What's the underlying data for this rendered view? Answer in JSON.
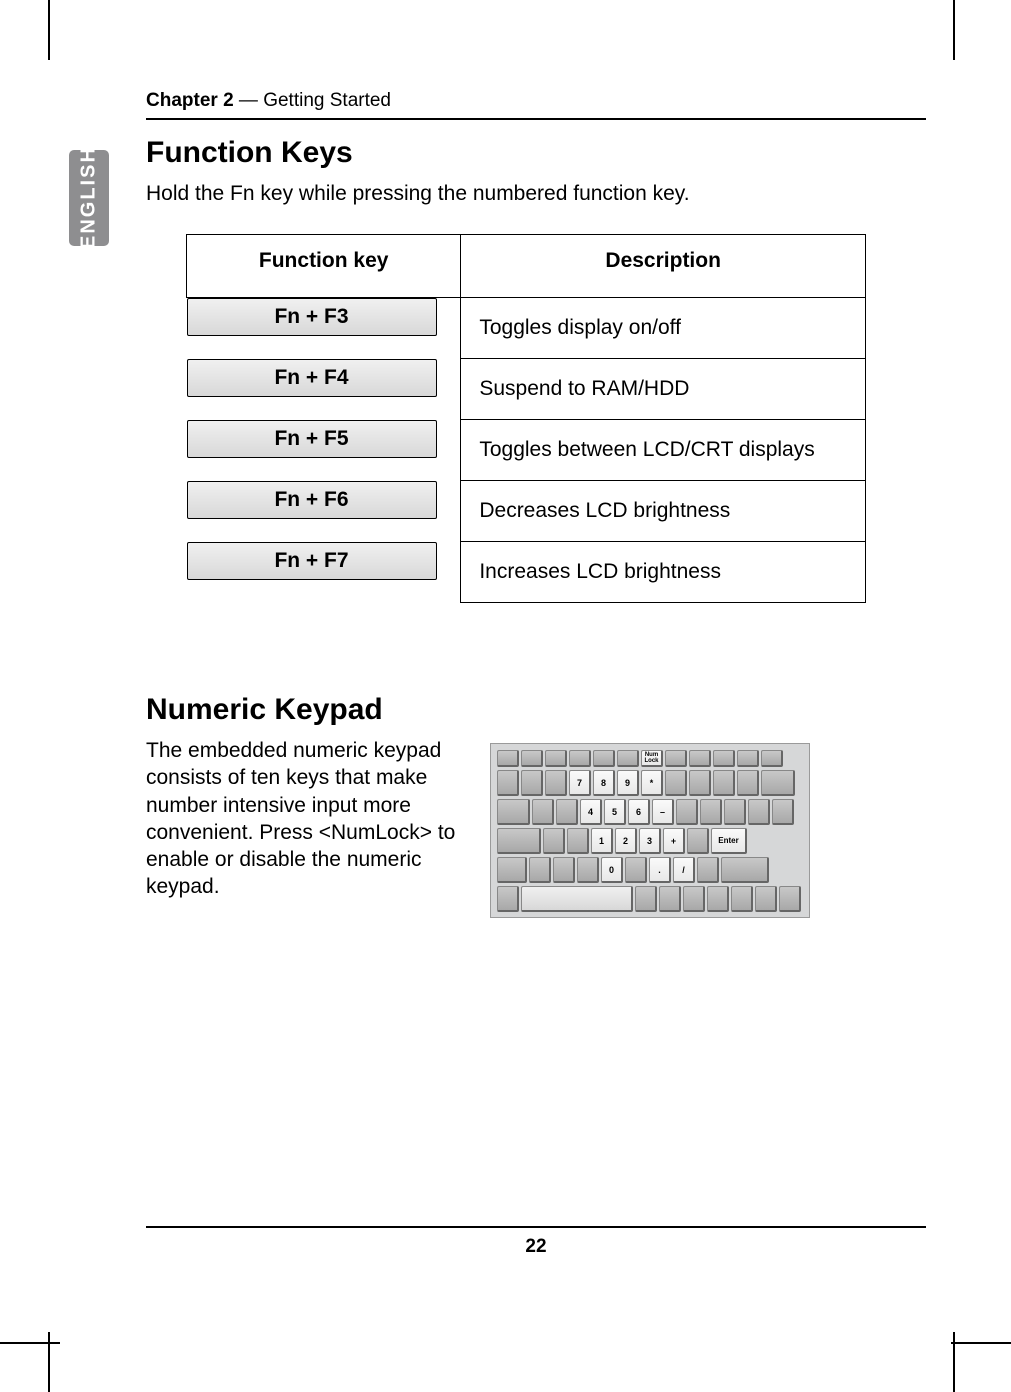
{
  "chapter": {
    "bold": "Chapter 2",
    "sep": " — ",
    "rest": "Getting Started"
  },
  "language_tab": "ENGLISH",
  "section1": {
    "heading": "Function Keys",
    "intro": "Hold the Fn key while pressing the numbered function key.",
    "columns": {
      "key": "Function key",
      "desc": "Description"
    },
    "rows": [
      {
        "key": "Fn + F3",
        "desc": "Toggles display on/off"
      },
      {
        "key": "Fn + F4",
        "desc": "Suspend to RAM/HDD"
      },
      {
        "key": "Fn + F5",
        "desc": "Toggles between LCD/CRT displays"
      },
      {
        "key": "Fn + F6",
        "desc": "Decreases LCD brightness"
      },
      {
        "key": "Fn + F7",
        "desc": "Increases LCD brightness"
      }
    ]
  },
  "section2": {
    "heading": "Numeric Keypad",
    "text": "The embedded numeric keypad consists of ten keys that make number intensive input more convenient. Press <NumLock> to enable or disable the numeric keypad."
  },
  "keypad_diagram": {
    "numlock_label": "Num Lock",
    "enter_label": "Enter",
    "row2": [
      "7",
      "8",
      "9",
      "*"
    ],
    "row3": [
      "4",
      "5",
      "6",
      "–"
    ],
    "row4": [
      "1",
      "2",
      "3",
      "+"
    ],
    "row5": [
      "0",
      ".",
      "/"
    ]
  },
  "chart_data": {
    "type": "table",
    "title": "Function Keys",
    "columns": [
      "Function key",
      "Description"
    ],
    "rows": [
      [
        "Fn + F3",
        "Toggles display on/off"
      ],
      [
        "Fn + F4",
        "Suspend to RAM/HDD"
      ],
      [
        "Fn + F5",
        "Toggles between LCD/CRT displays"
      ],
      [
        "Fn + F6",
        "Decreases LCD brightness"
      ],
      [
        "Fn + F7",
        "Increases LCD brightness"
      ]
    ]
  },
  "page_number": "22"
}
